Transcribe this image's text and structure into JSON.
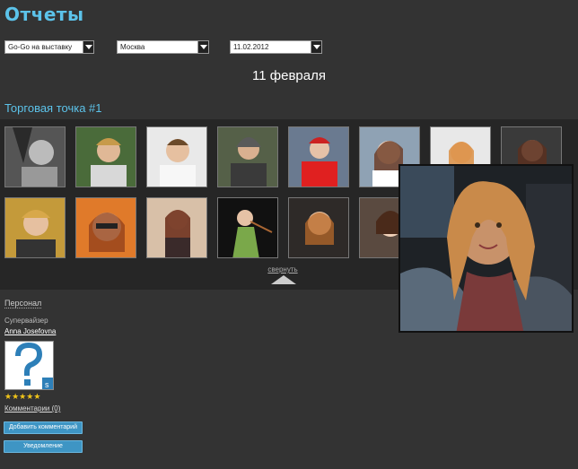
{
  "page": {
    "title": "Отчеты"
  },
  "filters": {
    "brand": "Go-Go на выставку",
    "city": "Москва",
    "date": "11.02.2012"
  },
  "report_date": "11 февраля",
  "point": {
    "title": "Торговая точка #1",
    "photos_row1": [
      "photo-1",
      "photo-2",
      "photo-3",
      "photo-4",
      "photo-5",
      "photo-6",
      "photo-7",
      "photo-8"
    ],
    "photos_row2": [
      "photo-9",
      "photo-10",
      "photo-11",
      "photo-12",
      "photo-13",
      "photo-14"
    ],
    "collapse_label": "свернуть"
  },
  "staff": {
    "section_label": "Персонал",
    "supervisor_label": "Супервайзер",
    "supervisor_name": "Anna Josefovna",
    "rating_stars": 5,
    "comments_label": "Комментарии (0)",
    "add_comment_label": "Добавить комментарий",
    "notify_label": "Уведомление"
  },
  "colors": {
    "accent": "#5cc3ea",
    "button": "#3e95c4",
    "background": "#333333",
    "gallery": "#262626"
  }
}
